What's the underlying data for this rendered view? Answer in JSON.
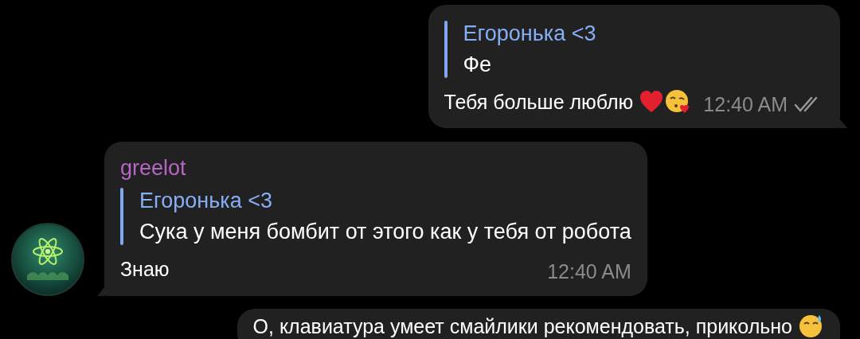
{
  "messages": [
    {
      "kind": "outgoing",
      "reply": {
        "author": "Егоронька <3",
        "text": "Фе"
      },
      "text": "Тебя больше люблю",
      "icons": [
        {
          "kind": "heart"
        },
        {
          "kind": "kiss"
        }
      ],
      "time": "12:40 AM",
      "read": true
    },
    {
      "kind": "incoming",
      "sender": "greelot",
      "reply": {
        "author": "Егоронька <3",
        "text": "Сука у меня бомбит от этого как у тебя от робота"
      },
      "text": "Знаю",
      "time": "12:40 AM"
    },
    {
      "kind": "outgoing",
      "text": "О, клавиатура умеет смайлики рекомендовать, прикольно",
      "icons": [
        {
          "kind": "sweat"
        }
      ]
    }
  ]
}
